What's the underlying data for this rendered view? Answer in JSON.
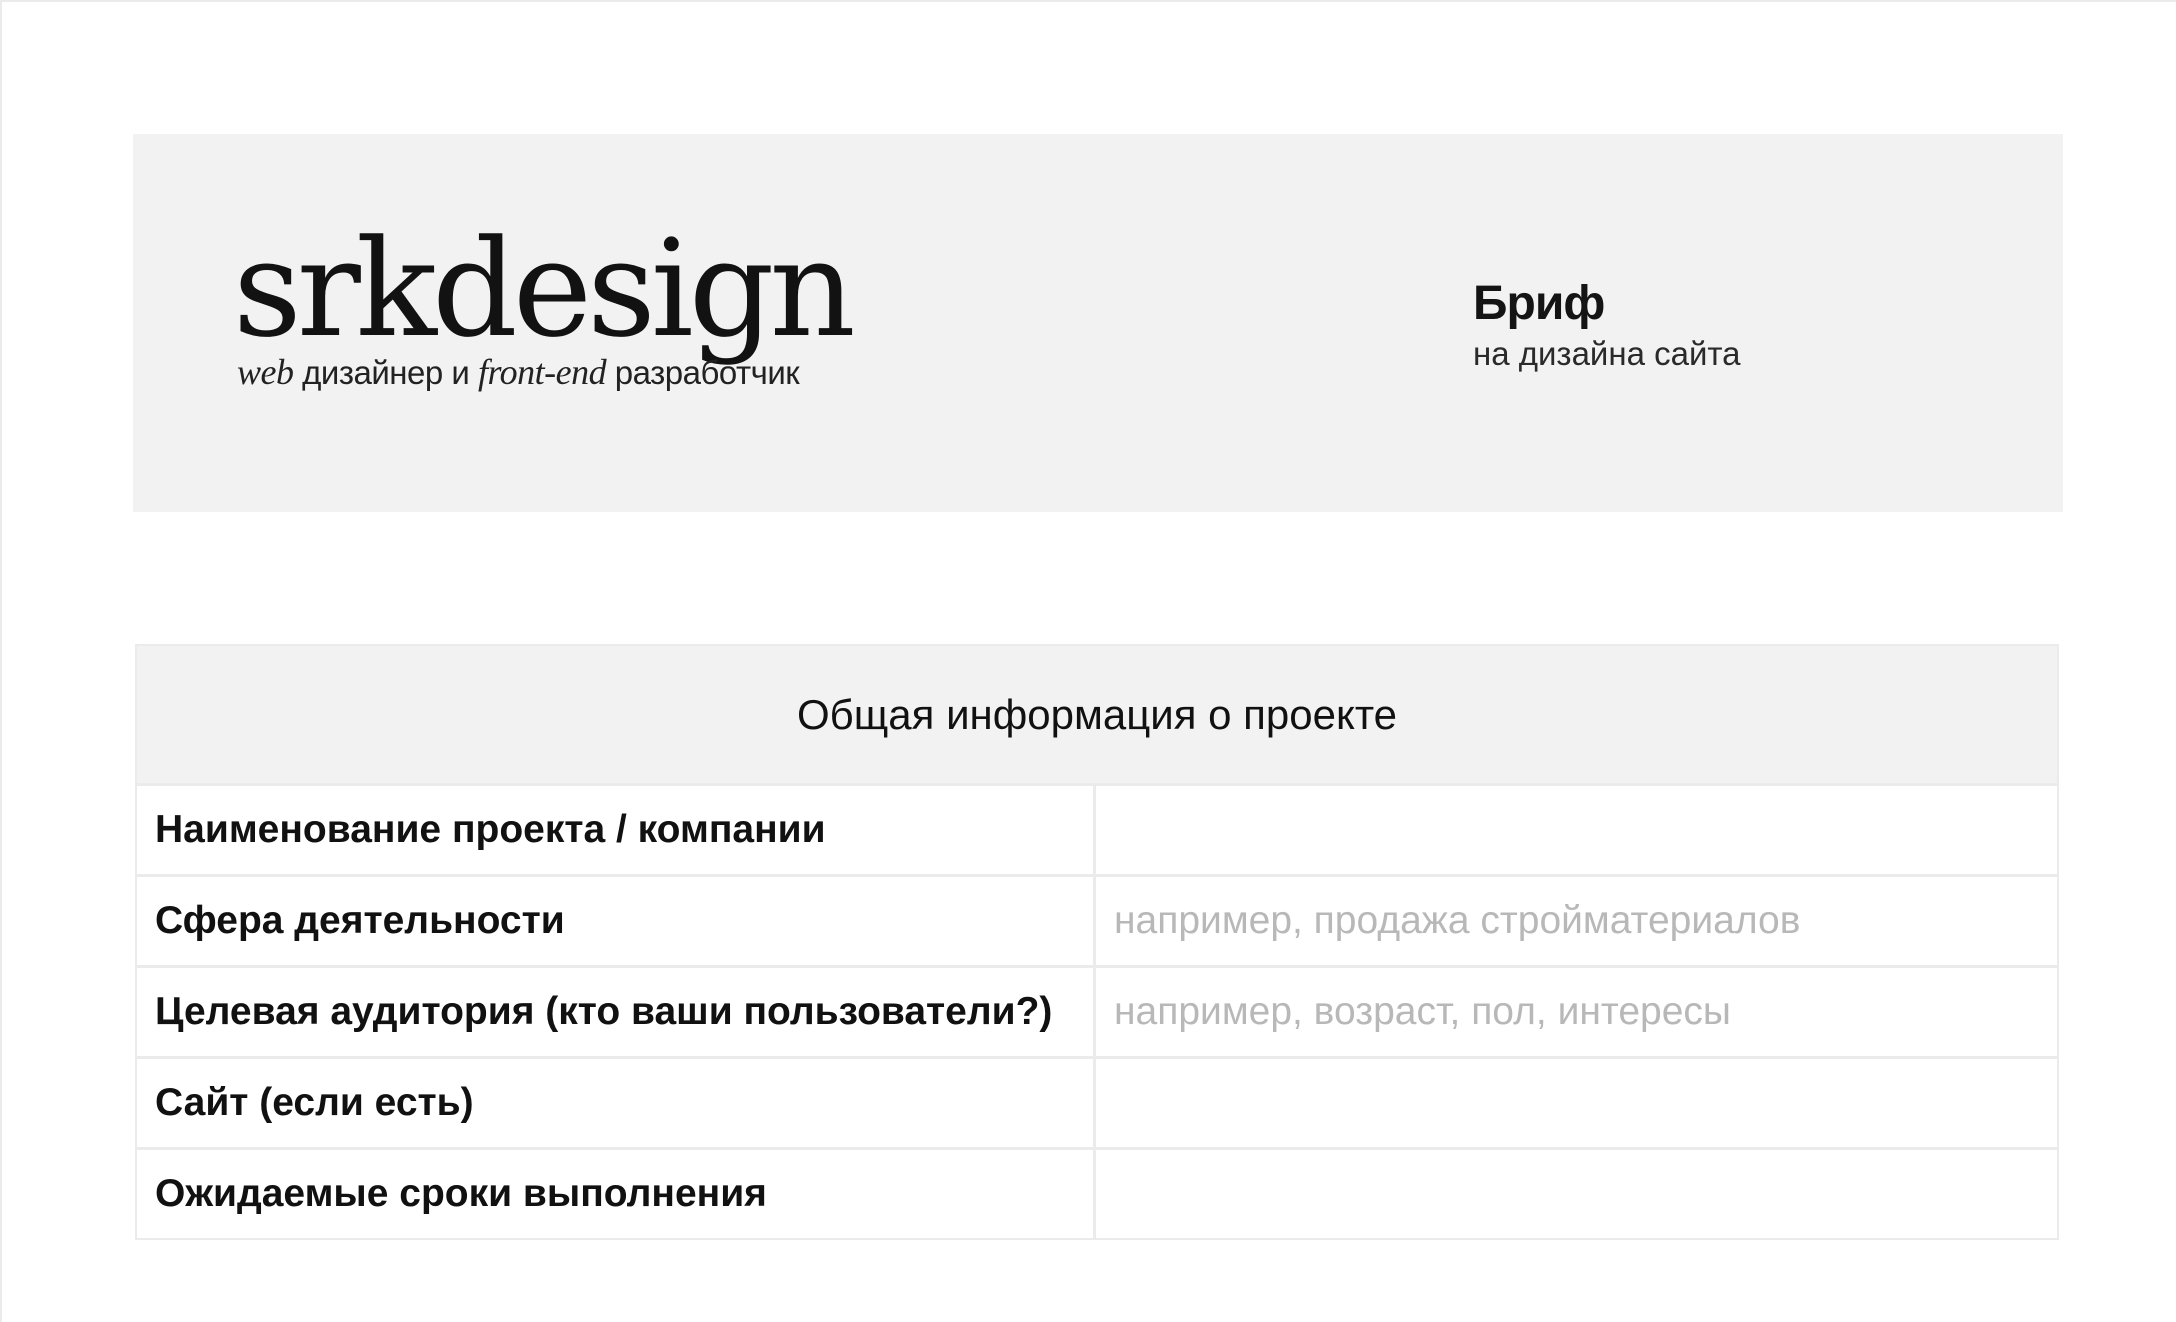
{
  "header": {
    "logo": {
      "wordmark": "srkdesign",
      "tagline_italic_1": "web",
      "tagline_1": " дизайнер и ",
      "tagline_italic_2": "front-end",
      "tagline_2": " разработчик"
    },
    "brief": {
      "title": "Бриф",
      "subtitle": "на дизайна сайта"
    }
  },
  "table": {
    "title": "Общая информация о проекте",
    "rows": [
      {
        "label": "Наименование проекта / компании",
        "value": ""
      },
      {
        "label": "Сфера деятельности",
        "value": "например, продажа стройматериалов"
      },
      {
        "label": "Целевая аудитория (кто ваши пользователи?)",
        "value": "например, возраст, пол, интересы"
      },
      {
        "label": "Сайт (если есть)",
        "value": ""
      },
      {
        "label": "Ожидаемые сроки выполнения",
        "value": ""
      }
    ]
  },
  "colors": {
    "banner_bg": "#f2f2f2",
    "border": "#ebebeb",
    "text": "#111111",
    "placeholder": "#b8b8b8"
  }
}
